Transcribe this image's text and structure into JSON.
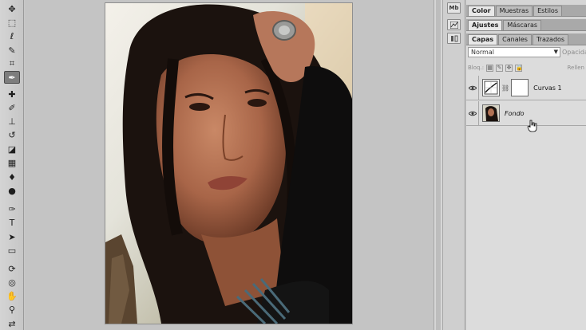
{
  "toolbar": {
    "tools": [
      {
        "id": "move",
        "icon": "move-icon",
        "glyph": "✥"
      },
      {
        "id": "marquee",
        "icon": "rectangular-marquee-icon",
        "glyph": "⬚"
      },
      {
        "id": "lasso",
        "icon": "lasso-icon",
        "glyph": "ℓ"
      },
      {
        "id": "quick-select",
        "icon": "quick-selection-icon",
        "glyph": "✎"
      },
      {
        "id": "crop",
        "icon": "crop-icon",
        "glyph": "⌗"
      },
      {
        "id": "eyedropper",
        "icon": "eyedropper-icon",
        "glyph": "✒"
      },
      {
        "id": "healing",
        "icon": "healing-brush-icon",
        "glyph": "✚"
      },
      {
        "id": "brush",
        "icon": "brush-icon",
        "glyph": "✐"
      },
      {
        "id": "stamp",
        "icon": "clone-stamp-icon",
        "glyph": "⊥"
      },
      {
        "id": "history-brush",
        "icon": "history-brush-icon",
        "glyph": "↺"
      },
      {
        "id": "eraser",
        "icon": "eraser-icon",
        "glyph": "◪"
      },
      {
        "id": "gradient",
        "icon": "gradient-icon",
        "glyph": "▦"
      },
      {
        "id": "blur",
        "icon": "blur-icon",
        "glyph": "♦"
      },
      {
        "id": "dodge",
        "icon": "dodge-icon",
        "glyph": "●"
      },
      {
        "id": "pen",
        "icon": "pen-icon",
        "glyph": "✑"
      },
      {
        "id": "type",
        "icon": "type-icon",
        "glyph": "T"
      },
      {
        "id": "path-select",
        "icon": "path-selection-icon",
        "glyph": "➤"
      },
      {
        "id": "shape",
        "icon": "rectangle-shape-icon",
        "glyph": "▭"
      },
      {
        "id": "3d-rotate",
        "icon": "3d-rotate-icon",
        "glyph": "⟳"
      },
      {
        "id": "3d-orbit",
        "icon": "3d-orbit-icon",
        "glyph": "◎"
      },
      {
        "id": "hand",
        "icon": "hand-icon",
        "glyph": "✋"
      },
      {
        "id": "zoom",
        "icon": "zoom-icon",
        "glyph": "⚲"
      },
      {
        "id": "swap",
        "icon": "swap-colors-icon",
        "glyph": "⇄"
      }
    ]
  },
  "dock": {
    "top_label": "Mb",
    "icons": [
      "adjustments-dock-icon",
      "history-dock-icon"
    ]
  },
  "panels": {
    "color_group": {
      "tabs": [
        "Color",
        "Muestras",
        "Estilos"
      ],
      "active": "Color"
    },
    "adjust_group": {
      "tabs": [
        "Ajustes",
        "Máscaras"
      ],
      "active": "Ajustes"
    },
    "layers_group": {
      "tabs": [
        "Capas",
        "Canales",
        "Trazados"
      ],
      "active": "Capas"
    },
    "layers": {
      "blend_mode": "Normal",
      "opacity_label": "Opacida",
      "lock_label": "Bloq.:",
      "fill_label": "Rellen",
      "items": [
        {
          "name": "Curvas 1",
          "type": "adjustment",
          "italic": false
        },
        {
          "name": "Fondo",
          "type": "background",
          "italic": true
        }
      ]
    }
  },
  "colors": {
    "ui_bg": "#c8c8c8",
    "panel_bg": "#d5d5d5",
    "active_tab": "#e8e8e8",
    "hair": "#1b120e",
    "skin": "#b8765a"
  }
}
